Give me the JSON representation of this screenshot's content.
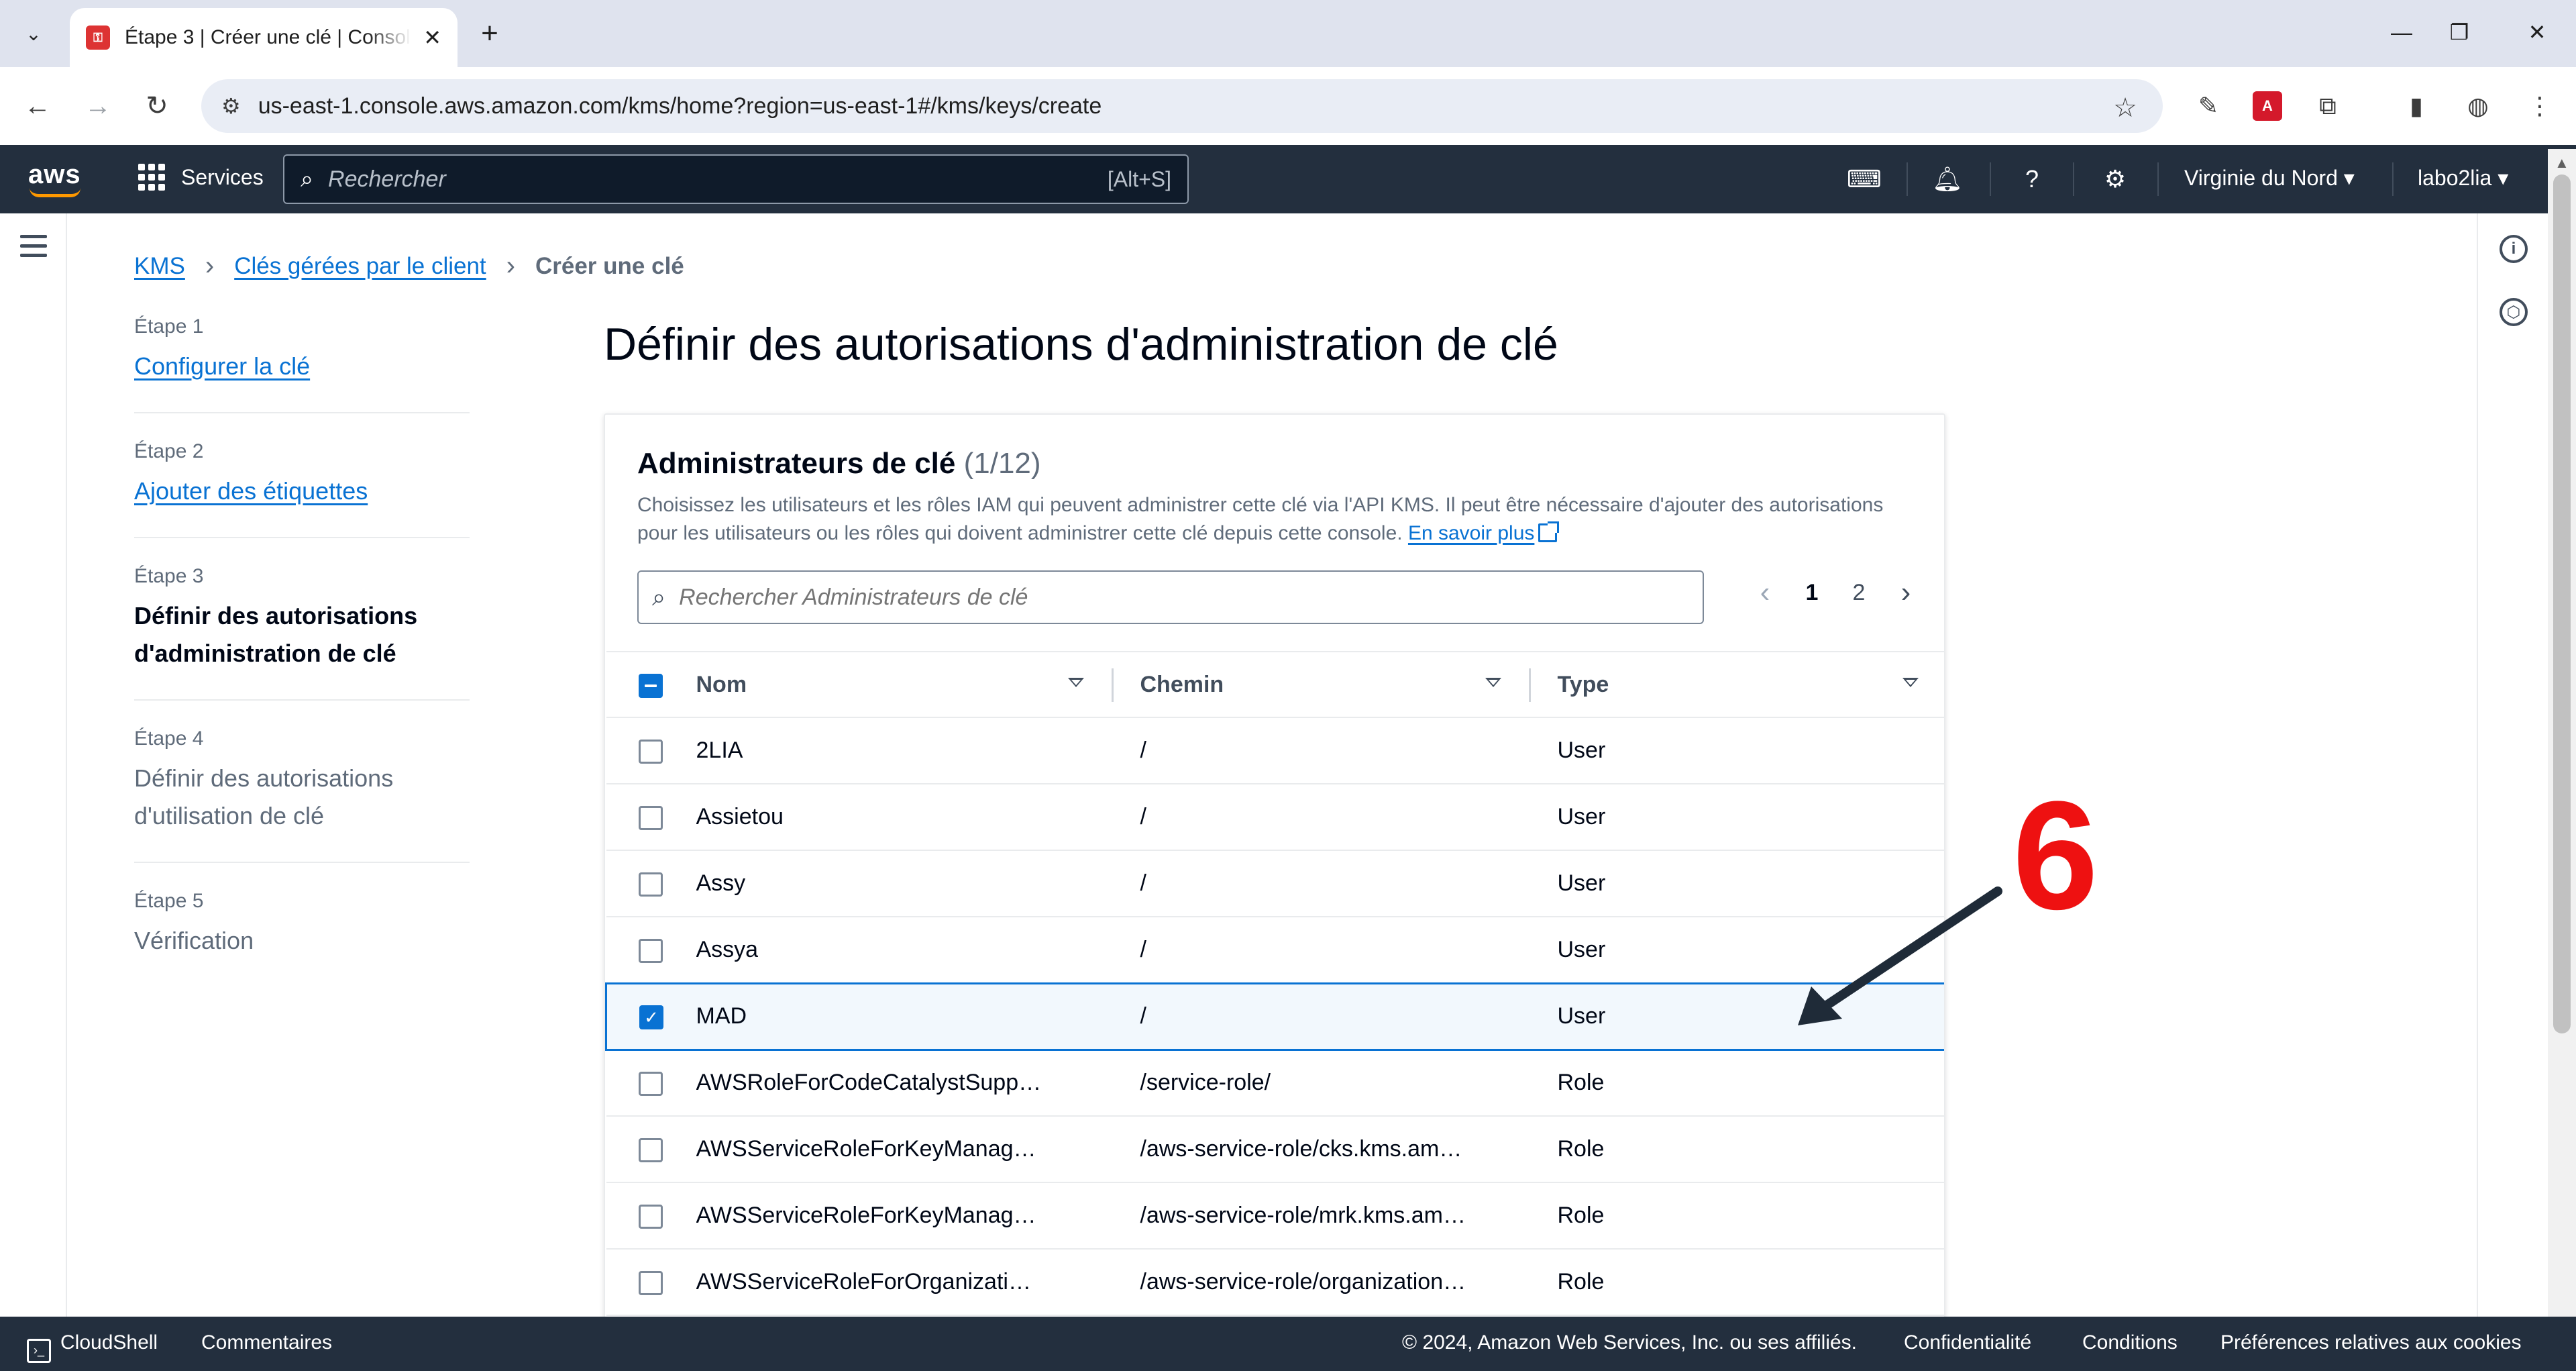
{
  "browser": {
    "tab_title": "Étape 3 | Créer une clé | Console",
    "new_tab_icon": "plus-icon",
    "url": "us-east-1.console.aws.amazon.com/kms/home?region=us-east-1#/kms/keys/create"
  },
  "aws_nav": {
    "logo": "aws",
    "services_label": "Services",
    "search_placeholder": "Rechercher",
    "search_shortcut": "[Alt+S]",
    "region": "Virginie du Nord",
    "account": "labo2lia"
  },
  "breadcrumb": {
    "items": [
      "KMS",
      "Clés gérées par le client"
    ],
    "current": "Créer une clé"
  },
  "steps": [
    {
      "num": "Étape 1",
      "label": "Configurer la clé",
      "state": "link"
    },
    {
      "num": "Étape 2",
      "label": "Ajouter des étiquettes",
      "state": "link"
    },
    {
      "num": "Étape 3",
      "label": "Définir des autorisations d'administration de clé",
      "state": "current"
    },
    {
      "num": "Étape 4",
      "label": "Définir des autorisations d'utilisation de clé",
      "state": "disabled"
    },
    {
      "num": "Étape 5",
      "label": "Vérification",
      "state": "disabled"
    }
  ],
  "page_title": "Définir des autorisations d'administration de clé",
  "panel": {
    "title": "Administrateurs de clé",
    "count": "(1/12)",
    "description": "Choisissez les utilisateurs et les rôles IAM qui peuvent administrer cette clé via l'API KMS. Il peut être nécessaire d'ajouter des autorisations pour les utilisateurs ou les rôles qui doivent administrer cette clé depuis cette console.",
    "learn_more": "En savoir plus",
    "filter_placeholder": "Rechercher Administrateurs de clé",
    "pages": [
      "1",
      "2"
    ],
    "current_page": "1"
  },
  "table": {
    "columns": [
      "Nom",
      "Chemin",
      "Type"
    ],
    "rows": [
      {
        "name": "2LIA",
        "path": "/",
        "type": "User",
        "checked": false
      },
      {
        "name": "Assietou",
        "path": "/",
        "type": "User",
        "checked": false
      },
      {
        "name": "Assy",
        "path": "/",
        "type": "User",
        "checked": false
      },
      {
        "name": "Assya",
        "path": "/",
        "type": "User",
        "checked": false
      },
      {
        "name": "MAD",
        "path": "/",
        "type": "User",
        "checked": true
      },
      {
        "name": "AWSRoleForCodeCatalystSupp…",
        "path": "/service-role/",
        "type": "Role",
        "checked": false
      },
      {
        "name": "AWSServiceRoleForKeyManag…",
        "path": "/aws-service-role/cks.kms.am…",
        "type": "Role",
        "checked": false
      },
      {
        "name": "AWSServiceRoleForKeyManag…",
        "path": "/aws-service-role/mrk.kms.am…",
        "type": "Role",
        "checked": false
      },
      {
        "name": "AWSServiceRoleForOrganizati…",
        "path": "/aws-service-role/organization…",
        "type": "Role",
        "checked": false
      }
    ]
  },
  "annotation": {
    "number": "6",
    "color": "#ee1111"
  },
  "footer": {
    "cloudshell": "CloudShell",
    "feedback": "Commentaires",
    "copyright": "© 2024, Amazon Web Services, Inc. ou ses affiliés.",
    "privacy": "Confidentialité",
    "terms": "Conditions",
    "cookies": "Préférences relatives aux cookies"
  },
  "colors": {
    "aws_dark": "#232f3e",
    "link": "#0972d3",
    "accent": "#ff9900"
  }
}
